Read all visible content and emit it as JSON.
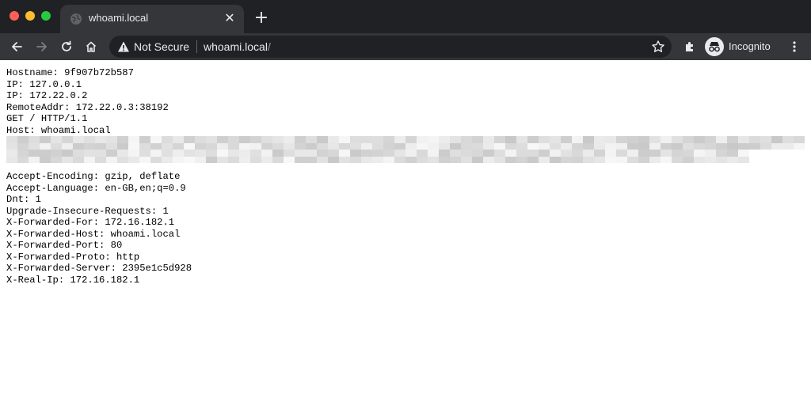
{
  "browser": {
    "tab_title": "whoami.local",
    "new_tab_symbol": "+",
    "close_symbol": "✕",
    "security_label": "Not Secure",
    "url_host": "whoami.local",
    "url_path": "/",
    "profile_label": "Incognito",
    "icons": [
      "back-arrow-icon",
      "forward-arrow-icon",
      "reload-icon",
      "home-icon",
      "warning-icon",
      "star-icon",
      "extensions-icon",
      "incognito-icon",
      "more-vert-icon",
      "globe-icon"
    ],
    "window_controls": [
      "close",
      "minimize",
      "zoom"
    ]
  },
  "page": {
    "lines_top": [
      "Hostname: 9f907b72b587",
      "IP: 127.0.0.1",
      "IP: 172.22.0.2",
      "RemoteAddr: 172.22.0.3:38192",
      "GET / HTTP/1.1",
      "Host: whoami.local"
    ],
    "redacted_rows": 2,
    "lines_bottom": [
      "Accept-Encoding: gzip, deflate",
      "Accept-Language: en-GB,en;q=0.9",
      "Dnt: 1",
      "Upgrade-Insecure-Requests: 1",
      "X-Forwarded-For: 172.16.182.1",
      "X-Forwarded-Host: whoami.local",
      "X-Forwarded-Port: 80",
      "X-Forwarded-Proto: http",
      "X-Forwarded-Server: 2395e1c5d928",
      "X-Real-Ip: 172.16.182.1"
    ]
  }
}
